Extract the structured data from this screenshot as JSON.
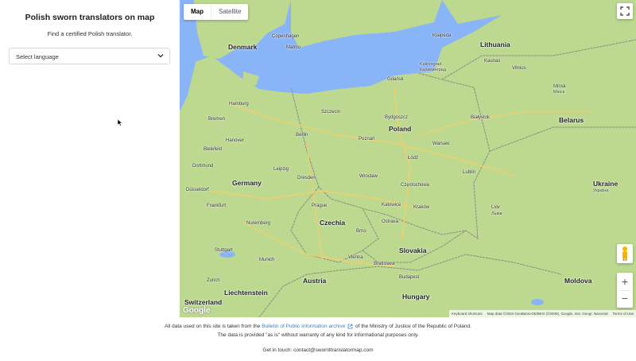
{
  "sidebar": {
    "title": "Polish sworn translators on map",
    "subtitle": "Find a certified Polish translator.",
    "language_select": {
      "selected": "Select language"
    }
  },
  "map": {
    "type_tabs": [
      {
        "label": "Map",
        "active": true
      },
      {
        "label": "Satellite",
        "active": false
      }
    ],
    "google_logo": "Google",
    "attribution": {
      "shortcuts": "Keyboard shortcuts",
      "data": "Map data ©2022 GeoBasis-DE/BKG (©2009), Google, Inst. Geogr. Nacional",
      "terms": "Terms of Use"
    },
    "zoom_in": "+",
    "zoom_out": "−",
    "colors": {
      "land": "#b9d88b",
      "water": "#8ab4f8",
      "border": "#7a7a7a",
      "road": "#f4d36b"
    },
    "countries": [
      "Denmark",
      "Lithuania",
      "Poland",
      "Belarus",
      "Germany",
      "Czechia",
      "Slovakia",
      "Ukraine",
      "Україна",
      "Austria",
      "Hungary",
      "Moldova",
      "Liechtenstein",
      "Switzerland"
    ],
    "cities": [
      "Copenhagen",
      "Malmo",
      "Klaipėda",
      "Kaunas",
      "Vilnius",
      "Kaliningrad",
      "Калининград",
      "Gdańsk",
      "Hamburg",
      "Szczecin",
      "Bydgoszcz",
      "Białystok",
      "Bremen",
      "Minsk",
      "Мінск",
      "Hanover",
      "Berlin",
      "Poznań",
      "Warsaw",
      "Bielefeld",
      "Dortmund",
      "Łódź",
      "Düsseldorf",
      "Leipzig",
      "Wrocław",
      "Lublin",
      "Dresden",
      "Częstochowa",
      "Frankfurt",
      "Prague",
      "Katowice",
      "Kraków",
      "Lviv",
      "Львів",
      "Nuremberg",
      "Brno",
      "Ostrava",
      "Stuttgart",
      "Munich",
      "Vienna",
      "Bratislava",
      "Zurich",
      "Budapest"
    ]
  },
  "footer": {
    "line1_prefix": "All data used on this site is taken from the",
    "line1_link": "Bulletin of Public Information archive",
    "line1_suffix": "of the Ministry of Justice of the Republic of Poland.",
    "line2": "The data is provided \"as is\" without warranty of any kind for informational purposes only.",
    "line3": "Get in touch: contact@swornttranslatormap.com"
  }
}
